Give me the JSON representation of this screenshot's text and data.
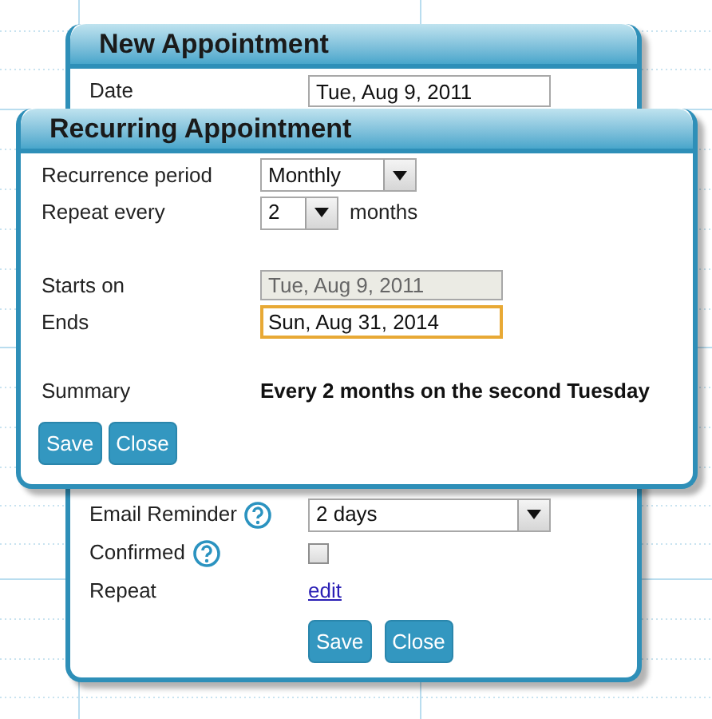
{
  "new_appointment": {
    "title": "New Appointment",
    "date": {
      "label": "Date",
      "value": "Tue, Aug 9, 2011"
    },
    "email_reminder": {
      "label": "Email Reminder",
      "value": "2 days"
    },
    "confirmed": {
      "label": "Confirmed",
      "checked": false
    },
    "repeat": {
      "label": "Repeat",
      "link": "edit"
    },
    "buttons": [
      "Save",
      "Close"
    ]
  },
  "recurring_appointment": {
    "title": "Recurring Appointment",
    "recurrence_period": {
      "label": "Recurrence period",
      "value": "Monthly"
    },
    "repeat_every": {
      "label": "Repeat every",
      "value": "2",
      "unit": "months"
    },
    "starts_on": {
      "label": "Starts on",
      "value": "Tue, Aug 9, 2011",
      "disabled": true
    },
    "ends": {
      "label": "Ends",
      "value": "Sun, Aug 31, 2014",
      "disabled": false
    },
    "summary": {
      "label": "Summary",
      "value": "Every 2 months on the second Tuesday"
    },
    "buttons": [
      "Save",
      "Close"
    ]
  }
}
